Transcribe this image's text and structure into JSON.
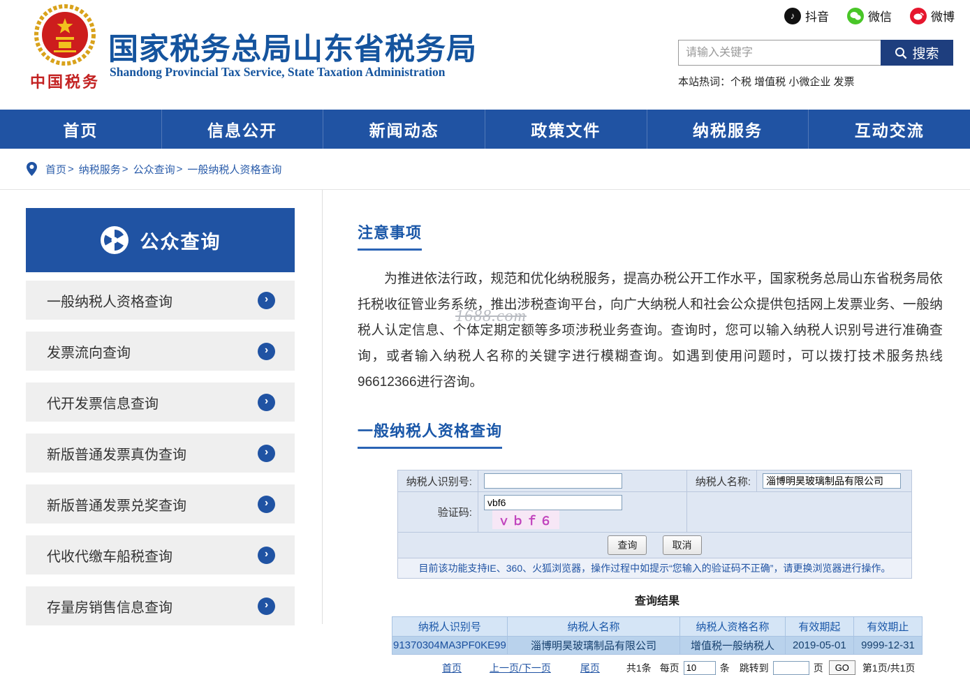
{
  "colors": {
    "brand_blue": "#2053a3",
    "logo_red": "#c32222",
    "result_row_bg": "#b9d2ec"
  },
  "header": {
    "logo_text": "中国税务",
    "title": "国家税务总局山东省税务局",
    "subtitle": "Shandong Provincial Tax Service, State Taxation Administration",
    "social": [
      {
        "name": "douyin",
        "label": "抖音"
      },
      {
        "name": "wechat",
        "label": "微信"
      },
      {
        "name": "weibo",
        "label": "微博"
      }
    ],
    "search": {
      "placeholder": "请输入关键字",
      "button_label": "搜索"
    },
    "hotwords": "本站热词：个税 增值税 小微企业 发票"
  },
  "nav": {
    "items": [
      "首页",
      "信息公开",
      "新闻动态",
      "政策文件",
      "纳税服务",
      "互动交流"
    ]
  },
  "breadcrumb": {
    "separator": ">",
    "items": [
      "首页",
      "纳税服务",
      "公众查询",
      "一般纳税人资格查询"
    ]
  },
  "sidebar": {
    "title": "公众查询",
    "items": [
      "一般纳税人资格查询",
      "发票流向查询",
      "代开发票信息查询",
      "新版普通发票真伪查询",
      "新版普通发票兑奖查询",
      "代收代缴车船税查询",
      "存量房销售信息查询"
    ]
  },
  "main": {
    "watermark": "1688.com",
    "notice": {
      "title": "注意事项",
      "text": "为推进依法行政，规范和优化纳税服务，提高办税公开工作水平，国家税务总局山东省税务局依托税收征管业务系统，推出涉税查询平台，向广大纳税人和社会公众提供包括网上发票业务、一般纳税人认定信息、个体定期定额等多项涉税业务查询。查询时，您可以输入纳税人识别号进行准确查询，或者输入纳税人名称的关键字进行模糊查询。如遇到使用问题时，可以拨打技术服务热线96612366进行咨询。"
    },
    "query": {
      "title": "一般纳税人资格查询",
      "form": {
        "taxpayer_id_label": "纳税人识别号:",
        "taxpayer_id_value": "",
        "taxpayer_name_label": "纳税人名称:",
        "taxpayer_name_value": "淄博明昊玻璃制品有限公司",
        "captcha_label": "验证码:",
        "captcha_value": "vbf6",
        "captcha_image_text": "ｖｂｆ６",
        "query_button": "查询",
        "cancel_button": "取消",
        "browser_note": "目前该功能支持IE、360、火狐浏览器，操作过程中如提示“您输入的验证码不正确”，请更换浏览器进行操作。"
      }
    },
    "results": {
      "title": "查询结果",
      "headers": [
        "纳税人识别号",
        "纳税人名称",
        "纳税人资格名称",
        "有效期起",
        "有效期止"
      ],
      "rows": [
        [
          "91370304MA3PF0KE99",
          "淄博明昊玻璃制品有限公司",
          "增值税一般纳税人",
          "2019-05-01",
          "9999-12-31"
        ]
      ],
      "pagination": {
        "first": "首页",
        "prev_next": "上一页/下一页",
        "last": "尾页",
        "total": "共1条",
        "per_page_label": "每页",
        "per_page_value": "10",
        "per_page_unit": "条",
        "jump_label": "跳转到",
        "jump_unit": "页",
        "go_label": "GO",
        "page_info": "第1页/共1页"
      }
    }
  }
}
